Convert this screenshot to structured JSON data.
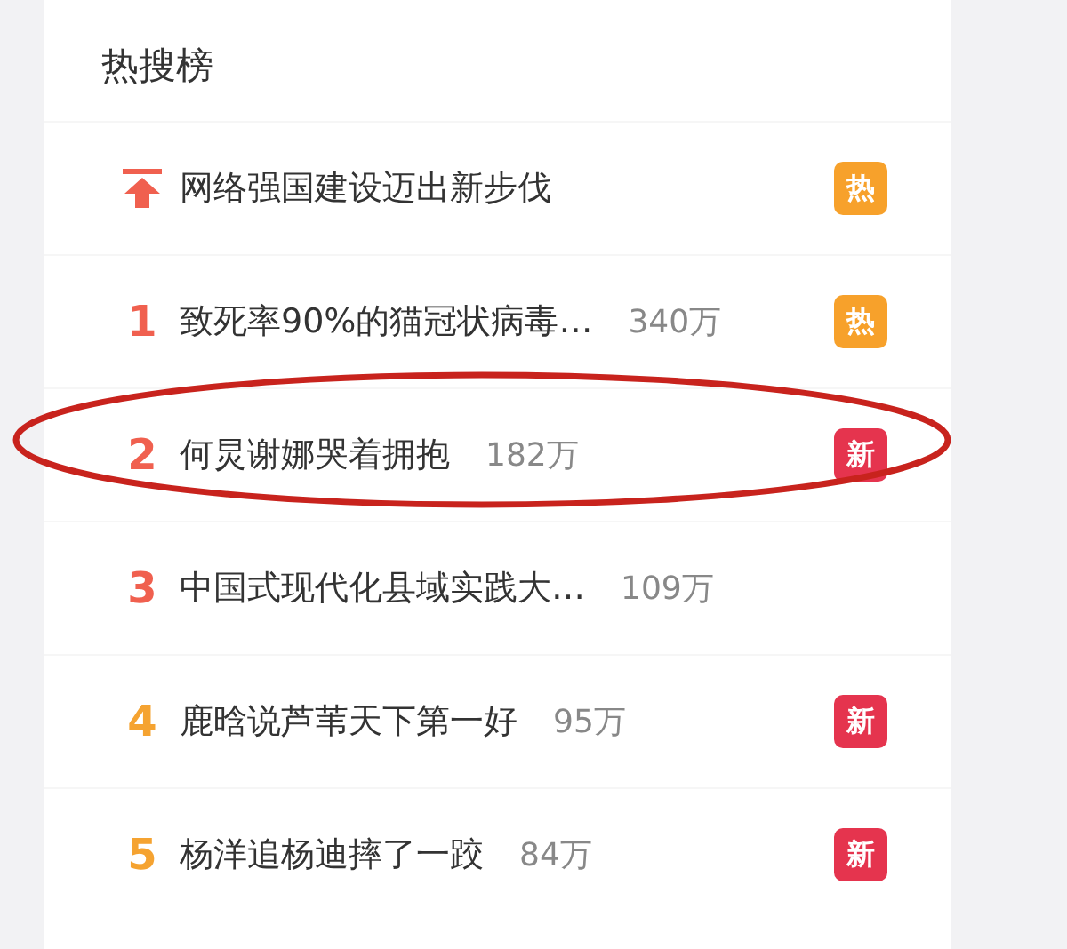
{
  "title": "热搜榜",
  "items": [
    {
      "kind": "pinned",
      "title": "网络强国建设迈出新步伐",
      "badge": {
        "kind": "hot",
        "text": "热"
      },
      "circled": false
    },
    {
      "kind": "ranked",
      "rank": "1",
      "color": "#f0604f",
      "title": "致死率90%的猫冠状病毒…",
      "count": "340万",
      "badge": {
        "kind": "hot",
        "text": "热"
      },
      "circled": false
    },
    {
      "kind": "ranked",
      "rank": "2",
      "color": "#f0604f",
      "title": "何炅谢娜哭着拥抱",
      "count": "182万",
      "badge": {
        "kind": "new",
        "text": "新"
      },
      "circled": true
    },
    {
      "kind": "ranked",
      "rank": "3",
      "color": "#f0604f",
      "title": "中国式现代化县域实践大…",
      "count": "109万",
      "circled": false
    },
    {
      "kind": "ranked",
      "rank": "4",
      "color": "#f5a331",
      "title": "鹿晗说芦苇天下第一好",
      "count": "95万",
      "badge": {
        "kind": "new",
        "text": "新"
      },
      "circled": false
    },
    {
      "kind": "ranked",
      "rank": "5",
      "color": "#f5a331",
      "title": "杨洋追杨迪摔了一跤",
      "count": "84万",
      "badge": {
        "kind": "new",
        "text": "新"
      },
      "circled": false
    }
  ]
}
